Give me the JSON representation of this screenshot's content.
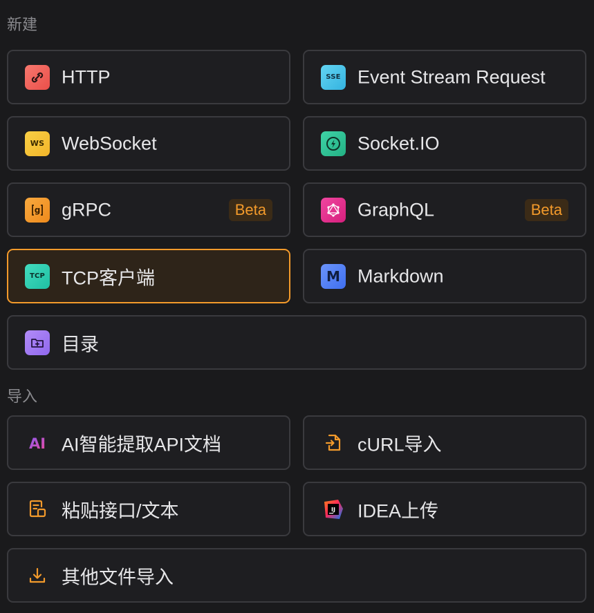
{
  "sections": {
    "new_title": "新建",
    "import_title": "导入"
  },
  "new_items": {
    "http": {
      "label": "HTTP",
      "icon": "http-link-icon",
      "color": "#f0645c"
    },
    "sse": {
      "label": "Event Stream Request",
      "icon_text": "SSE",
      "icon": "sse-icon",
      "color": "#4cc6ea"
    },
    "websocket": {
      "label": "WebSocket",
      "icon_text": "WS",
      "icon": "websocket-icon",
      "color": "#f6c333"
    },
    "socketio": {
      "label": "Socket.IO",
      "icon": "socketio-icon",
      "color": "#35c89a"
    },
    "grpc": {
      "label": "gRPC",
      "badge": "Beta",
      "icon": "grpc-icon",
      "color": "#f29a2e"
    },
    "graphql": {
      "label": "GraphQL",
      "badge": "Beta",
      "icon": "graphql-icon",
      "color": "#e8338f"
    },
    "tcp": {
      "label": "TCP客户端",
      "icon_text": "TCP",
      "icon": "tcp-icon",
      "color": "#2ed0b4",
      "selected": true
    },
    "markdown": {
      "label": "Markdown",
      "icon_text": "M",
      "icon": "markdown-icon",
      "color": "#4f7df5"
    },
    "folder": {
      "label": "目录",
      "icon": "folder-plus-icon",
      "color": "#a47cf3"
    }
  },
  "import_items": {
    "ai": {
      "label": "AI智能提取API文档",
      "icon_text": "AI",
      "icon": "ai-icon",
      "color": "#9b5cf6"
    },
    "curl": {
      "label": "cURL导入",
      "icon": "file-import-icon",
      "color": "#f39a2b"
    },
    "paste": {
      "label": "粘贴接口/文本",
      "icon": "paste-document-icon",
      "color": "#f39a2b"
    },
    "idea": {
      "label": "IDEA上传",
      "icon_text": "IJ",
      "icon": "intellij-idea-icon",
      "color": "#e8338f"
    },
    "other": {
      "label": "其他文件导入",
      "icon": "download-icon",
      "color": "#f39a2b"
    }
  }
}
